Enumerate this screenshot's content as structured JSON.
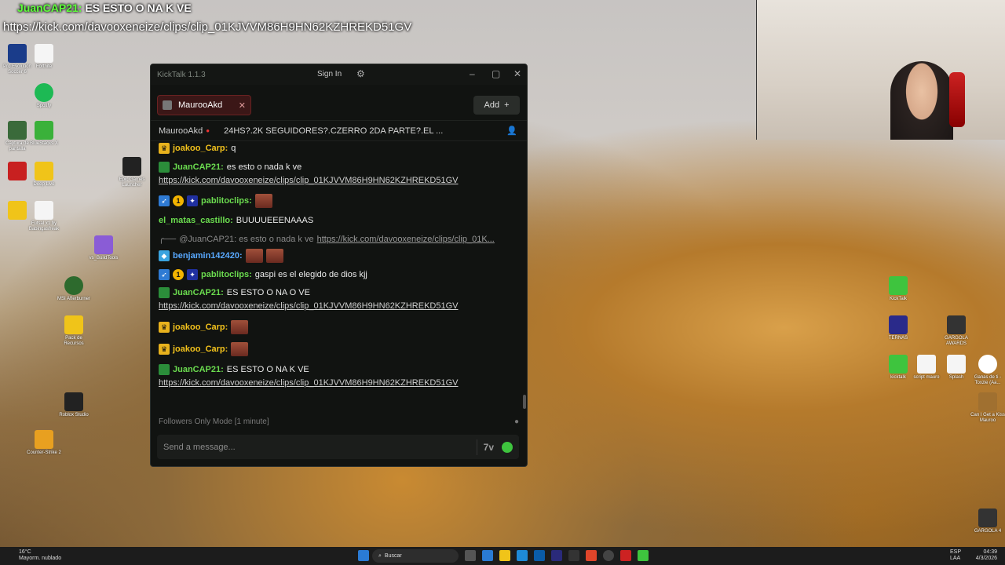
{
  "overlay": {
    "user": "JuanCAP21:",
    "message": " ES ESTO O NA K VE",
    "url": "https://kick.com/davooxeneize/clips/clip_01KJVVM86H9HN62KZHREKD51GV"
  },
  "window": {
    "title": "KickTalk 1.1.3",
    "signin": "Sign In",
    "tab_label": "MaurooAkd",
    "add_label": "Add",
    "channel": "MaurooAkd",
    "stream_title": "24HS?.2K SEGUIDORES?.CZERRO 2DA PARTE?.EL ...",
    "followers_mode": "Followers Only Mode [1 minute]",
    "input_placeholder": "Send a message..."
  },
  "messages": [
    {
      "user": "joakoo_Carp:",
      "text": "q"
    },
    {
      "user": "JuanCAP21:",
      "text": "es esto o nada k ve",
      "link": "https://kick.com/davooxeneize/clips/clip_01KJVVM86H9HN62KZHREKD51GV"
    },
    {
      "user": "pablitoclips:",
      "text": ""
    },
    {
      "user": "el_matas_castillo:",
      "text": "BUUUUEEENAAAS"
    },
    {
      "reply_prefix": "@JuanCAP21: es esto o nada k ve",
      "reply_link": "https://kick.com/davooxeneize/clips/clip_01K..."
    },
    {
      "user": "benjamin142420:",
      "text": ""
    },
    {
      "user": "pablitoclips:",
      "text": "gaspi es el elegido de dios kjj"
    },
    {
      "user": "JuanCAP21:",
      "text": "ES ESTO O NA O VE",
      "link": "https://kick.com/davooxeneize/clips/clip_01KJVVM86H9HN62KZHREKD51GV"
    },
    {
      "user": "joakoo_Carp:",
      "text": ""
    },
    {
      "user": "joakoo_Carp:",
      "text": ""
    },
    {
      "user": "JuanCAP21:",
      "text": "ES ESTO O NA K VE",
      "link": "https://kick.com/davooxeneize/clips/clip_01KJVVM86H9HN62KZHREKD51GV"
    }
  ],
  "taskbar": {
    "weather_temp": "16°C",
    "weather_desc": "Mayorm. nublado",
    "search": "Buscar",
    "lang1": "ESP",
    "lang2": "LAA",
    "time": "04:39",
    "date": "4/3/2026"
  },
  "desktop_icons": {
    "label_1": "Pro Evolution Soccer 6",
    "label_2": "Fortnite",
    "label_3": "Spotify",
    "label_4": "Captura de pantalla",
    "label_5": "BlueStacks X",
    "label_6": "Epic Games Launcher",
    "label_7": "Roblox Studio",
    "label_8": "Counter-Strike 2",
    "label_9": "TERNAS",
    "label_10": "KickTalk",
    "label_11": "Pack de Recursos",
    "label_12": "Deep Live",
    "label_13": "Futsal x1 by Babingasfreak",
    "label_14": "vs_BuildTools",
    "label_15": "MSI Afterburner",
    "label_16": "GARGOLA AWARDS",
    "label_17": "GARGOLA 4",
    "label_18": "Can I Get a Kiss Mauroo",
    "label_19": "Ganas de ti - Toxzie (Aa...",
    "label_20": "Splash",
    "label_21": "script mauro",
    "label_22": "kicktalk"
  },
  "colors": {
    "window_bg": "#111311",
    "tab_bg": "#3b1717",
    "kick_green": "#3ec43e",
    "user_yellow": "#f3c21c",
    "user_green": "#6bdc4f",
    "user_blue": "#58a8ff"
  }
}
